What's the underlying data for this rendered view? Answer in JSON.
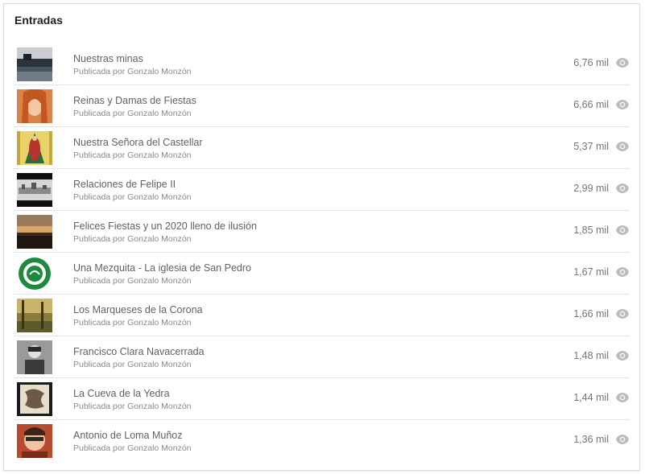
{
  "card": {
    "title": "Entradas"
  },
  "posts": [
    {
      "title": "Nuestras minas",
      "byline": "Publicada por Gonzalo Monzón",
      "views": "6,76 mil"
    },
    {
      "title": "Reinas y Damas de Fiestas",
      "byline": "Publicada por Gonzalo Monzón",
      "views": "6,66 mil"
    },
    {
      "title": "Nuestra Señora del Castellar",
      "byline": "Publicada por Gonzalo Monzón",
      "views": "5,37 mil"
    },
    {
      "title": "Relaciones de Felipe II",
      "byline": "Publicada por Gonzalo Monzón",
      "views": "2,99 mil"
    },
    {
      "title": "Felices Fiestas y un 2020 lleno de ilusión",
      "byline": "Publicada por Gonzalo Monzón",
      "views": "1,85 mil"
    },
    {
      "title": "Una Mezquita - La iglesia de San Pedro",
      "byline": "Publicada por Gonzalo Monzón",
      "views": "1,67 mil"
    },
    {
      "title": "Los Marqueses de la Corona",
      "byline": "Publicada por Gonzalo Monzón",
      "views": "1,66 mil"
    },
    {
      "title": "Francisco Clara Navacerrada",
      "byline": "Publicada por Gonzalo Monzón",
      "views": "1,48 mil"
    },
    {
      "title": "La Cueva de la Yedra",
      "byline": "Publicada por Gonzalo Monzón",
      "views": "1,44 mil"
    },
    {
      "title": "Antonio de Loma Muñoz",
      "byline": "Publicada por Gonzalo Monzón",
      "views": "1,36 mil"
    }
  ],
  "colors": {
    "text_primary": "#616161",
    "text_secondary": "#8a8a8a",
    "divider": "#e3e3e3",
    "eye_icon": "#bdbdbd"
  },
  "icons": {
    "views": "eye-icon"
  }
}
